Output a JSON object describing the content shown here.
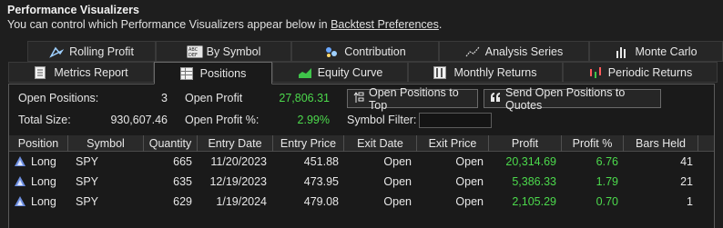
{
  "header": {
    "title": "Performance Visualizers",
    "subtitle_prefix": "You can control which Performance Visualizers appear below in ",
    "subtitle_link": "Backtest Preferences",
    "subtitle_suffix": "."
  },
  "tabs_row1": [
    {
      "label": "Rolling Profit",
      "icon": "rolling-profit-icon"
    },
    {
      "label": "By Symbol",
      "icon": "abc-symbol-icon"
    },
    {
      "label": "Contribution",
      "icon": "contribution-icon"
    },
    {
      "label": "Analysis Series",
      "icon": "analysis-series-icon"
    },
    {
      "label": "Monte Carlo",
      "icon": "monte-carlo-icon"
    }
  ],
  "tabs_row2": [
    {
      "label": "Metrics Report",
      "icon": "metrics-report-icon"
    },
    {
      "label": "Positions",
      "icon": "positions-icon",
      "active": true
    },
    {
      "label": "Equity Curve",
      "icon": "equity-curve-icon"
    },
    {
      "label": "Monthly Returns",
      "icon": "monthly-returns-icon"
    },
    {
      "label": "Periodic Returns",
      "icon": "periodic-returns-icon"
    }
  ],
  "summary": {
    "open_positions_label": "Open Positions:",
    "open_positions_value": "3",
    "open_profit_label": "Open Profit",
    "open_profit_value": "27,806.31",
    "total_size_label": "Total Size:",
    "total_size_value": "930,607.46",
    "open_profit_pct_label": "Open Profit %:",
    "open_profit_pct_value": "2.99%",
    "symbol_filter_label": "Symbol Filter:",
    "symbol_filter_value": ""
  },
  "buttons": {
    "open_to_top": "Open Positions to Top",
    "open_to_quotes": "Send Open Positions to Quotes"
  },
  "columns": [
    "Position",
    "Symbol",
    "Quantity",
    "Entry Date",
    "Entry Price",
    "Exit Date",
    "Exit Price",
    "Profit",
    "Profit %",
    "Bars Held"
  ],
  "rows": [
    {
      "position": "Long",
      "symbol": "SPY",
      "quantity": "665",
      "entry_date": "11/20/2023",
      "entry_price": "451.88",
      "exit_date": "Open",
      "exit_price": "Open",
      "profit": "20,314.69",
      "profit_pct": "6.76",
      "bars_held": "41"
    },
    {
      "position": "Long",
      "symbol": "SPY",
      "quantity": "635",
      "entry_date": "12/19/2023",
      "entry_price": "473.95",
      "exit_date": "Open",
      "exit_price": "Open",
      "profit": "5,386.33",
      "profit_pct": "1.79",
      "bars_held": "21"
    },
    {
      "position": "Long",
      "symbol": "SPY",
      "quantity": "629",
      "entry_date": "1/19/2024",
      "entry_price": "479.08",
      "exit_date": "Open",
      "exit_price": "Open",
      "profit": "2,105.29",
      "profit_pct": "0.70",
      "bars_held": "1"
    }
  ],
  "colors": {
    "profit_green": "#4cd94c",
    "long_marker": "#6e8fe0"
  }
}
